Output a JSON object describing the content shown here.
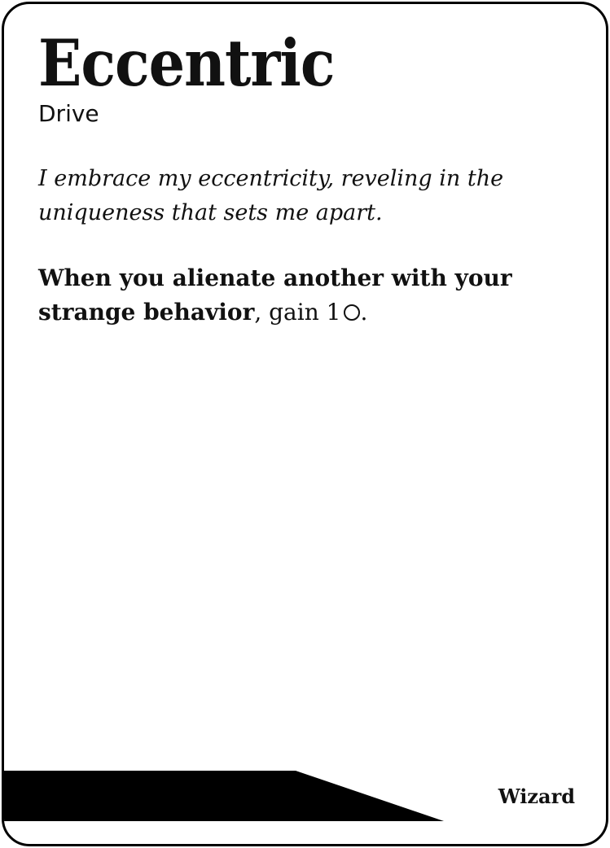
{
  "card": {
    "title": "Eccentric",
    "subtitle": "Drive",
    "flavor_text": "I embrace my eccentricity, reveling in the uniqueness that sets me apart.",
    "rule": {
      "trigger": "When you alienate another with your strange behavior",
      "effect_prefix": ", gain 1",
      "effect_suffix": ".",
      "icon": "circle-icon"
    },
    "class_label": "Wizard"
  },
  "colors": {
    "ink": "#111111",
    "background": "#ffffff",
    "border": "#000000"
  }
}
